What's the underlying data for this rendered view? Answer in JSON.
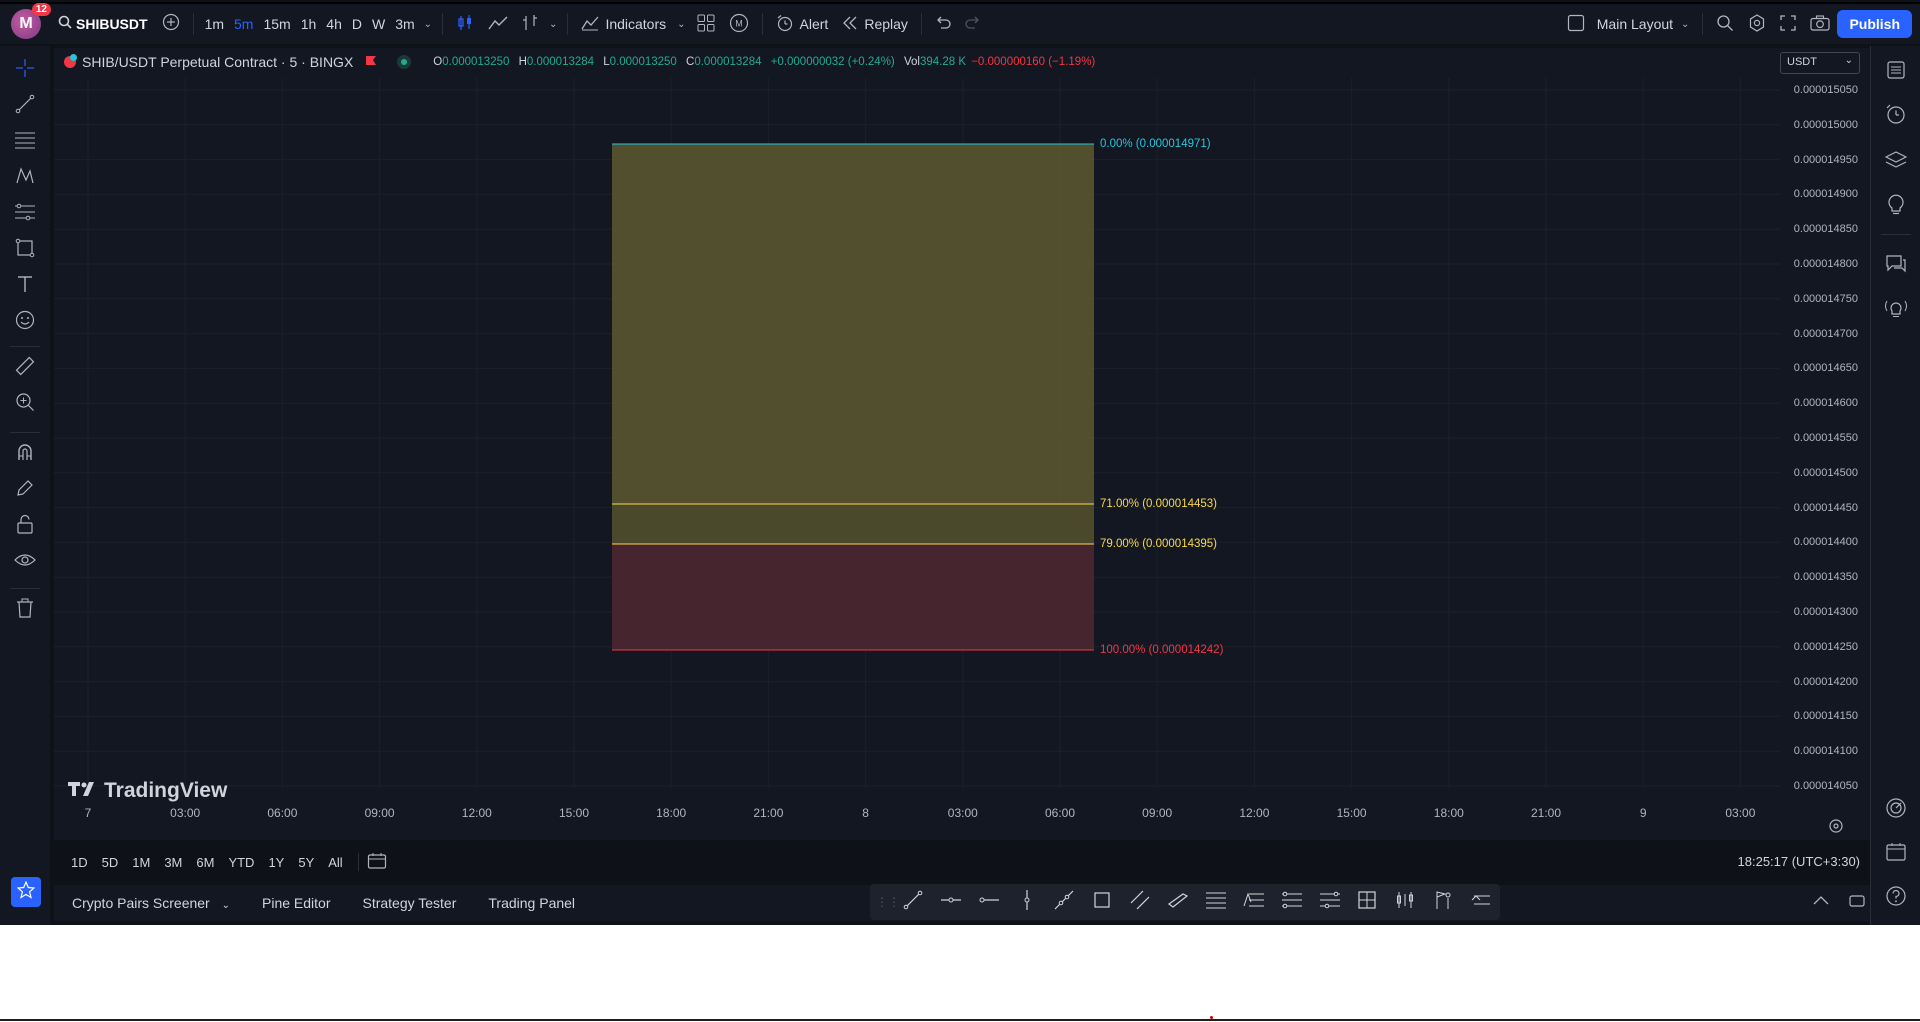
{
  "topbar": {
    "avatar_letter": "M",
    "notifications": "12",
    "symbol": "SHIBUSDT",
    "intervals": [
      "1m",
      "5m",
      "15m",
      "1h",
      "4h",
      "D",
      "W",
      "3m"
    ],
    "active_interval": "5m",
    "indicators_label": "Indicators",
    "alert_label": "Alert",
    "replay_label": "Replay",
    "layout_label": "Main Layout",
    "publish_label": "Publish"
  },
  "legend": {
    "title": "SHIB/USDT Perpetual Contract · 5 · BINGX",
    "o_key": "O",
    "o_val": "0.000013250",
    "h_key": "H",
    "h_val": "0.000013284",
    "l_key": "L",
    "l_val": "0.000013250",
    "c_key": "C",
    "c_val": "0.000013284",
    "change": "+0.000000032 (+0.24%)",
    "vol_key": "Vol",
    "vol_val": "394.28 K",
    "vol_change": "−0.000000160 (−1.19%)"
  },
  "currency": "USDT",
  "price_axis": [
    "0.000015050",
    "0.000015000",
    "0.000014950",
    "0.000014900",
    "0.000014850",
    "0.000014800",
    "0.000014750",
    "0.000014700",
    "0.000014650",
    "0.000014600",
    "0.000014550",
    "0.000014500",
    "0.000014450",
    "0.000014400",
    "0.000014350",
    "0.000014300",
    "0.000014250",
    "0.000014200",
    "0.000014150",
    "0.000014100",
    "0.000014050"
  ],
  "time_axis": [
    "7",
    "03:00",
    "06:00",
    "09:00",
    "12:00",
    "15:00",
    "18:00",
    "21:00",
    "8",
    "03:00",
    "06:00",
    "09:00",
    "12:00",
    "15:00",
    "18:00",
    "21:00",
    "9",
    "03:00"
  ],
  "fib": {
    "level_0": "0.00% (0.000014971)",
    "level_71": "71.00% (0.000014453)",
    "level_79": "79.00% (0.000014395)",
    "level_100": "100.00% (0.000014242)",
    "color_0": "#26c6da",
    "color_71": "#f7d84b",
    "color_79": "#f7d84b",
    "color_100": "#f23645"
  },
  "watermark": "TradingView",
  "ranges": [
    "1D",
    "5D",
    "1M",
    "3M",
    "6M",
    "YTD",
    "1Y",
    "5Y",
    "All"
  ],
  "clock": "18:25:17 (UTC+3:30)",
  "bottom_tabs": {
    "screener": "Crypto Pairs Screener",
    "pine": "Pine Editor",
    "strategy": "Strategy Tester",
    "trading": "Trading Panel"
  }
}
